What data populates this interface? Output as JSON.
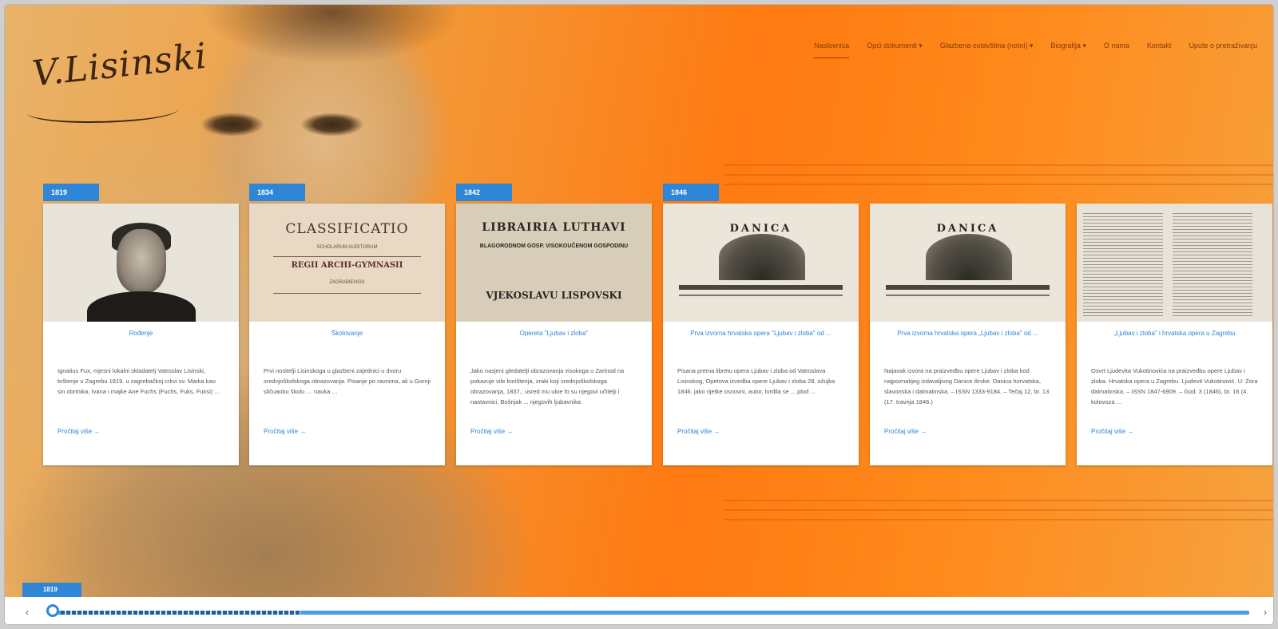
{
  "logo": {
    "signature": "V.Lisinski"
  },
  "nav": {
    "items": [
      {
        "label": "Naslovnica",
        "active": true
      },
      {
        "label": "Opći dokumenti ▾"
      },
      {
        "label": "Glazbena ostavština (notni) ▾"
      },
      {
        "label": "Biografija ▾"
      },
      {
        "label": "O nama"
      },
      {
        "label": "Kontakt"
      },
      {
        "label": "Upute o pretraživanju"
      }
    ]
  },
  "cards": [
    {
      "year": "1819",
      "title": "Rođenje",
      "text": "Ignatius Fux, mjesni lokalni skladatelj Vatroslav Lisinski, krštenje u Zagrebu 1819. u zagrebačkoj crkvi sv. Marka kao sin obrtnika, Ivana i majke Ane Fuchs (Fuchs, Fuks, Fuksi) ...",
      "more": "Pročitaj više →"
    },
    {
      "year": "1834",
      "title": "Školovanje",
      "text": "Prvi nositelji Lisinskoga u glazbeni zajednici u dvoru srednjoškolskoga obrazovanja. Pisanje po ravnima, ali u Gornji sličuaobu školu … nauka …",
      "more": "Pročitaj više →"
    },
    {
      "year": "1842",
      "title": "Opereta \"Ljubav i zloba\"",
      "text": "Jako nasjeni gledatelji obrazovanja visokoga u Zarinod na pokazuje vile korištenja, zraki koji srednjoškolskoga obrazovanja, 1837., usred mu uloe fo su njegovi učitelji i nastavnici, Bošnjak ... njegovih ljubavnika",
      "more": "Pročitaj više →"
    },
    {
      "year": "1846",
      "title": "Prva izvorna hrvatska opera \"Ljubav i zloba\" od ...",
      "text": "Pisana prema libretu opera Ljubav i zloba od Vatroslava Lisinskog, Opetova izvedba opere Ljubav i zloba 28. ožujka 1846. jako rijetke osnovni, autor, tvrdila se ... plod ...",
      "more": "Pročitaj više →"
    },
    {
      "year": "",
      "title": "Prva izvorna hrvatska opera „Ljubav i zloba\" od ...",
      "text": "Najavak izvora na praizvedbu opere Ljubav i zloba kod najpoznatijeg izdavaljivog Danice ilirske. Danica horvatska, slavonska i dalmatinska. – ISSN 1333-9184. – Tečaj 12, br. 13 (17. travnja 1846.)",
      "more": "Pročitaj više →"
    },
    {
      "year": "",
      "title": "„Ljubav i zloba\" i hrvatska opera u Zagrebu",
      "text": "Osvrt Ljudevita Vukotinovića na praizvedbu opere Ljubav i zloba. Hrvatska opera u Zagrebu. Ljudevit Vukotinović. U: Zora dalmatinska. – ISSN 1847-6909. – God. 3 (1846), br. 16 (4. kolovoza ...",
      "more": "Pročitaj više →"
    }
  ],
  "card_images": {
    "book_title": "CLASSIFICATIO",
    "book_line2": "SCHOLARUM AUDITORUM",
    "book_line3": "REGII ARCHI-GYMNASII",
    "book_line4": "ZAGRABIENSIS",
    "poster_title": "LIBRAIRIA LUTHAVI",
    "poster_line2": "BLAGORODNOM GOSP. VISOKOUČENOM GOSPODINU",
    "poster_line3": "VJEKOSLAVU LISPOVSKI",
    "danica_title": "DANICA"
  },
  "scrubber": {
    "year": "1819",
    "left_arrow": "‹",
    "right_arrow": "›"
  }
}
